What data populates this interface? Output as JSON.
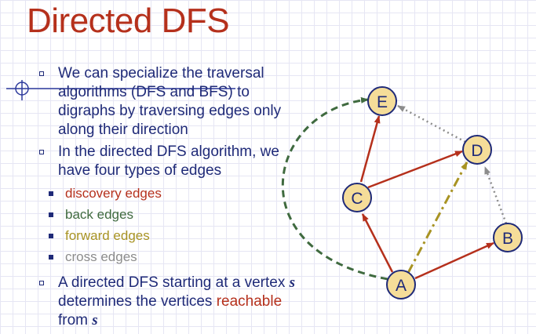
{
  "title": "Directed DFS",
  "bullets": {
    "b1": "We can specialize the traversal algorithms (DFS and BFS) to digraphs by traversing edges only along their direction",
    "b2": "In the directed DFS algorithm, we have four types of edges",
    "edge_types": [
      {
        "label": "discovery edges",
        "color": "#b5301c"
      },
      {
        "label": "back edges",
        "color": "#3f6a3f"
      },
      {
        "label": "forward edges",
        "color": "#a89323"
      },
      {
        "label": "cross edges",
        "color": "#8c8c8c"
      }
    ],
    "b3_part1": "A directed DFS starting at a vertex",
    "b3_var1": "s",
    "b3_part2": "determines the vertices",
    "b3_highlight": "reachable",
    "b3_part3": "from",
    "b3_var2": "s"
  },
  "graph": {
    "node_fill": "#f5dd99",
    "node_stroke": "#1f2a78",
    "labels": {
      "A": "A",
      "B": "B",
      "C": "C",
      "D": "D",
      "E": "E"
    }
  }
}
